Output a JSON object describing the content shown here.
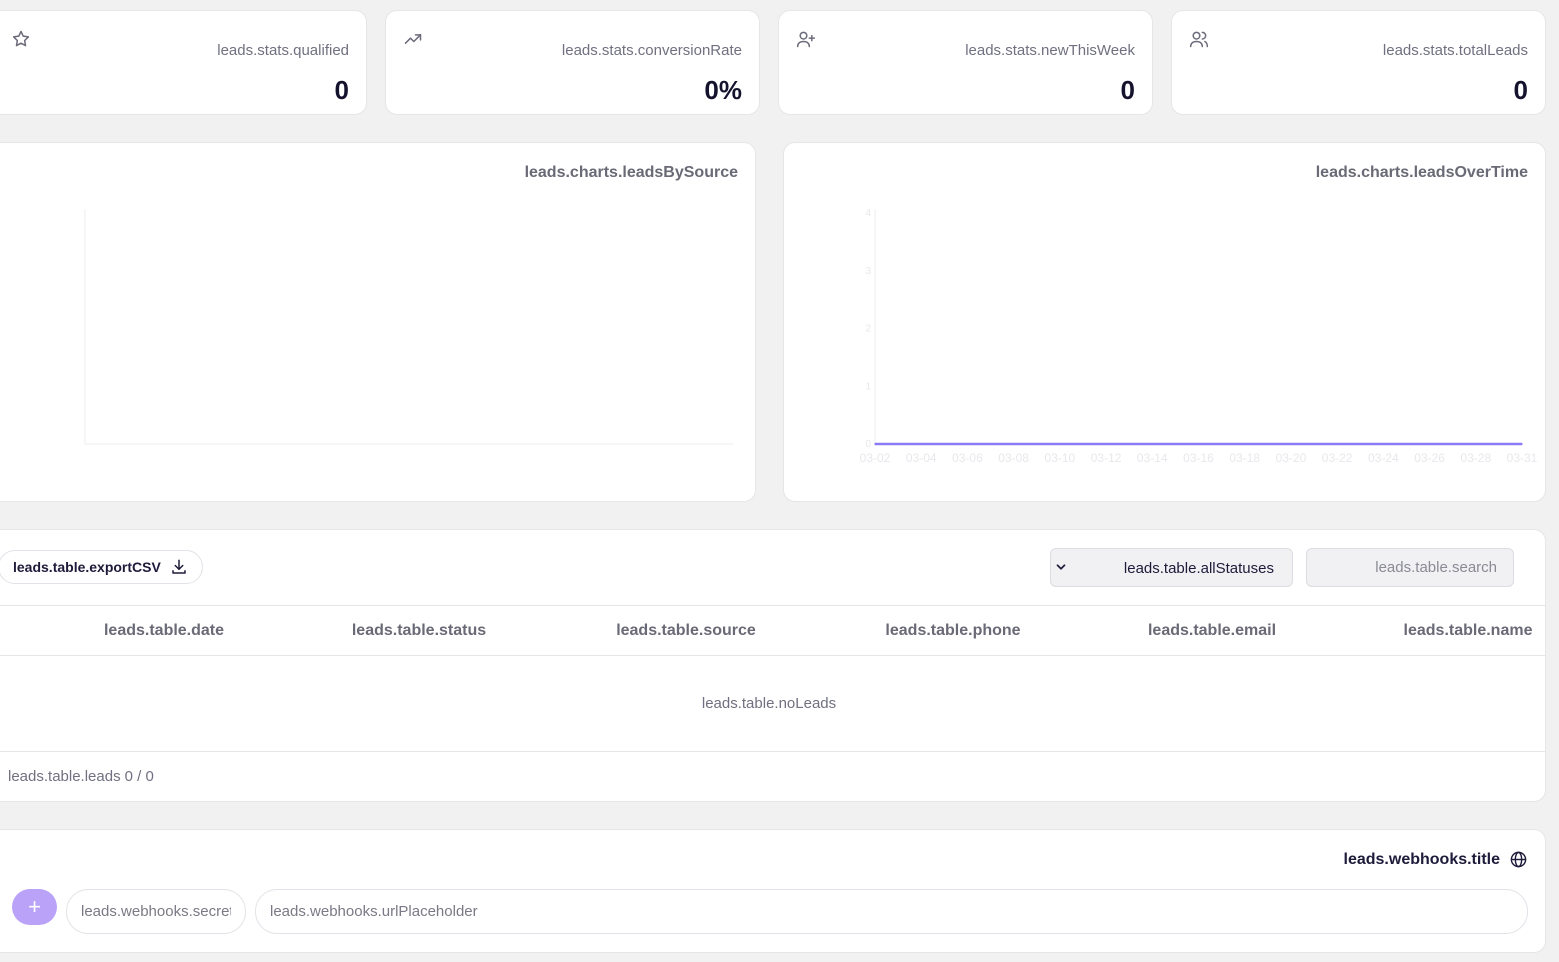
{
  "stats": [
    {
      "icon": "star-icon",
      "label": "leads.stats.qualified",
      "value": "0"
    },
    {
      "icon": "trending-up-icon",
      "label": "leads.stats.conversionRate",
      "value": "0%"
    },
    {
      "icon": "user-plus-icon",
      "label": "leads.stats.newThisWeek",
      "value": "0"
    },
    {
      "icon": "users-icon",
      "label": "leads.stats.totalLeads",
      "value": "0"
    }
  ],
  "charts": {
    "by_source_title": "leads.charts.leadsBySource",
    "over_time_title": "leads.charts.leadsOverTime"
  },
  "chart_data": [
    {
      "type": "bar",
      "title": "leads.charts.leadsBySource",
      "categories": [],
      "values": []
    },
    {
      "type": "line",
      "title": "leads.charts.leadsOverTime",
      "x": [
        "03-02",
        "03-04",
        "03-06",
        "03-08",
        "03-10",
        "03-12",
        "03-14",
        "03-16",
        "03-18",
        "03-20",
        "03-22",
        "03-24",
        "03-26",
        "03-28",
        "03-31"
      ],
      "y_ticks": [
        0,
        1,
        2,
        3,
        4
      ],
      "ylim": [
        0,
        4
      ],
      "series": [
        {
          "values": [
            0,
            0,
            0,
            0,
            0,
            0,
            0,
            0,
            0,
            0,
            0,
            0,
            0,
            0,
            0
          ],
          "color": "#8b7cf6"
        }
      ],
      "grid": false
    }
  ],
  "table": {
    "export_label": "leads.table.exportCSV",
    "status_filter": "leads.table.allStatuses",
    "search_placeholder": "leads.table.search",
    "columns": [
      "leads.table.date",
      "leads.table.status",
      "leads.table.source",
      "leads.table.phone",
      "leads.table.email",
      "leads.table.name"
    ],
    "empty_text": "leads.table.noLeads",
    "footer_label": "leads.table.leads",
    "footer_count": "0 / 0"
  },
  "webhooks": {
    "title": "leads.webhooks.title",
    "add_label": "+",
    "secret_placeholder": "leads.webhooks.secret",
    "url_placeholder": "leads.webhooks.urlPlaceholder"
  },
  "colors": {
    "accent": "#8b7cf6",
    "accent_light": "#b9a2f7"
  }
}
